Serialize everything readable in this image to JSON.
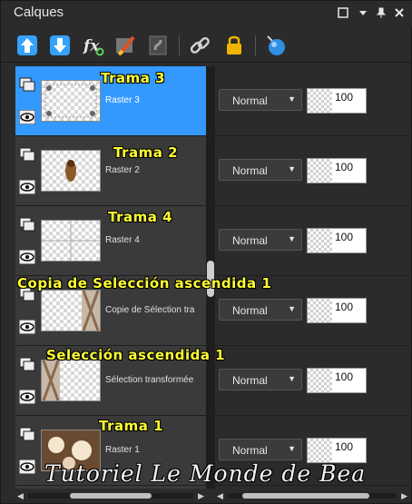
{
  "panel": {
    "title": "Calques"
  },
  "toolbar": {
    "tools": [
      "new-raster-layer-icon",
      "new-vector-layer-icon",
      "effects-fx-icon",
      "brush-icon",
      "mask-icon",
      "link-icon",
      "lock-icon",
      "sphere-icon"
    ]
  },
  "layers": [
    {
      "name": "Raster 3",
      "overlay": "Trama 3",
      "blend": "Normal",
      "opacity": "100",
      "selected": true
    },
    {
      "name": "Raster 2",
      "overlay": "Trama 2",
      "blend": "Normal",
      "opacity": "100",
      "selected": false
    },
    {
      "name": "Raster 4",
      "overlay": "Trama 4",
      "blend": "Normal",
      "opacity": "100",
      "selected": false
    },
    {
      "name": "Copie de Sélection tra",
      "overlay": "Copia de Selección ascendida 1",
      "blend": "Normal",
      "opacity": "100",
      "selected": false
    },
    {
      "name": "Sélection transformée",
      "overlay": "Selección ascendida 1",
      "blend": "Normal",
      "opacity": "100",
      "selected": false
    },
    {
      "name": "Raster 1",
      "overlay": "Trama 1",
      "blend": "Normal",
      "opacity": "100",
      "selected": false
    }
  ],
  "watermark": "Tutoriel Le Monde de Bea",
  "colors": {
    "selected": "#3399ff",
    "overlay_text": "#ffff33",
    "panel_bg": "#2b2b2b"
  }
}
